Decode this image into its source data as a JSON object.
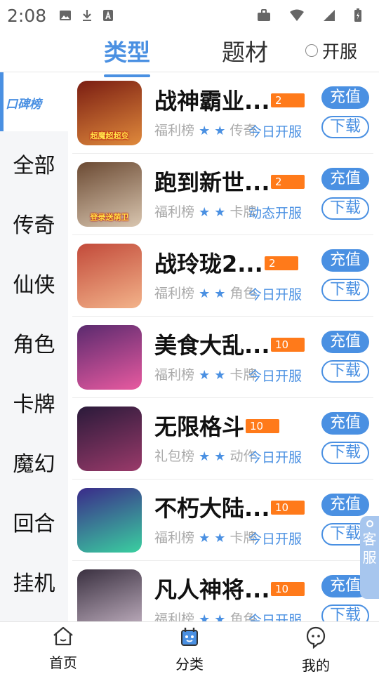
{
  "status_bar": {
    "time": "2:08"
  },
  "top_tabs": {
    "type": "类型",
    "theme": "题材",
    "open_server": "开服"
  },
  "sidebar": {
    "active": "口碑榜",
    "items": [
      "全部",
      "传奇",
      "仙侠",
      "角色",
      "卡牌",
      "魔幻",
      "回合",
      "挂机"
    ]
  },
  "games": [
    {
      "name": "战神霸业...",
      "badge": "2",
      "tags": [
        "福利榜",
        "传奇"
      ],
      "open": "今日开服",
      "thumb_caption": "超魔超超变",
      "colors": [
        "#7a1d12",
        "#e08a3c"
      ]
    },
    {
      "name": "跑到新世...",
      "badge": "2",
      "tags": [
        "福利榜",
        "卡牌"
      ],
      "open": "动态开服",
      "thumb_caption": "登录送萌卫",
      "colors": [
        "#6b4a33",
        "#d9c6b0"
      ]
    },
    {
      "name": "战玲珑2...",
      "badge": "2",
      "tags": [
        "福利榜",
        "角色"
      ],
      "open": "今日开服",
      "thumb_caption": "",
      "colors": [
        "#c24a3a",
        "#f3b38a"
      ]
    },
    {
      "name": "美食大乱...",
      "badge": "10",
      "tags": [
        "福利榜",
        "卡牌"
      ],
      "open": "今日开服",
      "thumb_caption": "",
      "colors": [
        "#5a2a6e",
        "#e85aa0"
      ]
    },
    {
      "name": "无限格斗",
      "badge": "10",
      "tags": [
        "礼包榜",
        "动作"
      ],
      "open": "今日开服",
      "thumb_caption": "",
      "colors": [
        "#2a1a3a",
        "#9a3a6a"
      ]
    },
    {
      "name": "不朽大陆...",
      "badge": "10",
      "tags": [
        "福利榜",
        "卡牌"
      ],
      "open": "今日开服",
      "thumb_caption": "",
      "colors": [
        "#3a2a8a",
        "#3ad0a0"
      ]
    },
    {
      "name": "凡人神将...",
      "badge": "10",
      "tags": [
        "福利榜",
        "角色"
      ],
      "open": "今日开服",
      "thumb_caption": "",
      "colors": [
        "#3a3040",
        "#c9b8c8"
      ]
    }
  ],
  "buttons": {
    "charge": "充值",
    "download": "下载"
  },
  "floating_service": "客服",
  "bottom_nav": {
    "home": "首页",
    "category": "分类",
    "mine": "我的"
  },
  "colors": {
    "accent": "#4a90e2",
    "badge": "#ff7a1a"
  }
}
